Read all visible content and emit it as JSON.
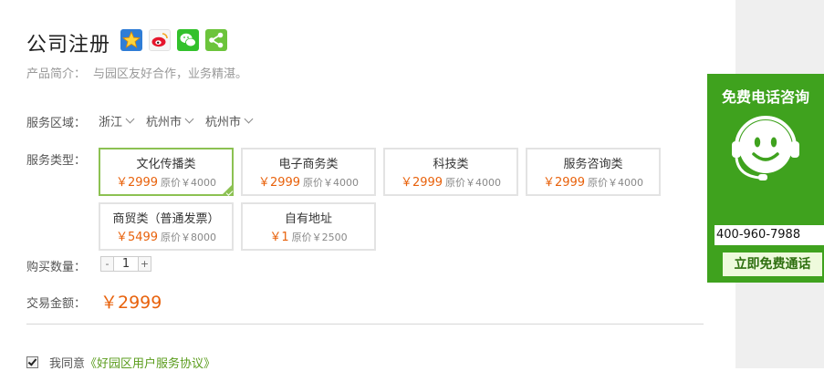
{
  "product": {
    "title": "公司注册",
    "intro_label": "产品简介：",
    "intro_text": "与园区友好合作，业务精湛。"
  },
  "share_icons": [
    "qzone-icon",
    "weibo-icon",
    "wechat-icon",
    "share-icon"
  ],
  "region": {
    "label": "服务区域：",
    "province": "浙江",
    "city": "杭州市",
    "district": "杭州市"
  },
  "service_type": {
    "label": "服务类型：",
    "options": [
      {
        "name": "文化传播类",
        "price": "￥2999",
        "original": "原价￥4000",
        "selected": true
      },
      {
        "name": "电子商务类",
        "price": "￥2999",
        "original": "原价￥4000",
        "selected": false
      },
      {
        "name": "科技类",
        "price": "￥2999",
        "original": "原价￥4000",
        "selected": false
      },
      {
        "name": "服务咨询类",
        "price": "￥2999",
        "original": "原价￥4000",
        "selected": false
      },
      {
        "name": "商贸类（普通发票）",
        "price": "￥5499",
        "original": "原价￥8000",
        "selected": false
      },
      {
        "name": "自有地址",
        "price": "￥1",
        "original": "原价￥2500",
        "selected": false
      }
    ]
  },
  "quantity": {
    "label": "购买数量：",
    "minus": "-",
    "value": "1",
    "plus": "+"
  },
  "amount": {
    "label": "交易金额：",
    "value": "￥2999"
  },
  "agreement": {
    "checked": true,
    "text": "我同意",
    "link": "《好园区用户服务协议》"
  },
  "consult_panel": {
    "title": "免费电话咨询",
    "phone": "400-960-7988",
    "button": "立即免费通话"
  },
  "colors": {
    "accent_green": "#3fa21e",
    "selected_border": "#8cc152",
    "price_orange": "#e8620c",
    "link_green": "#5a9c1c"
  }
}
